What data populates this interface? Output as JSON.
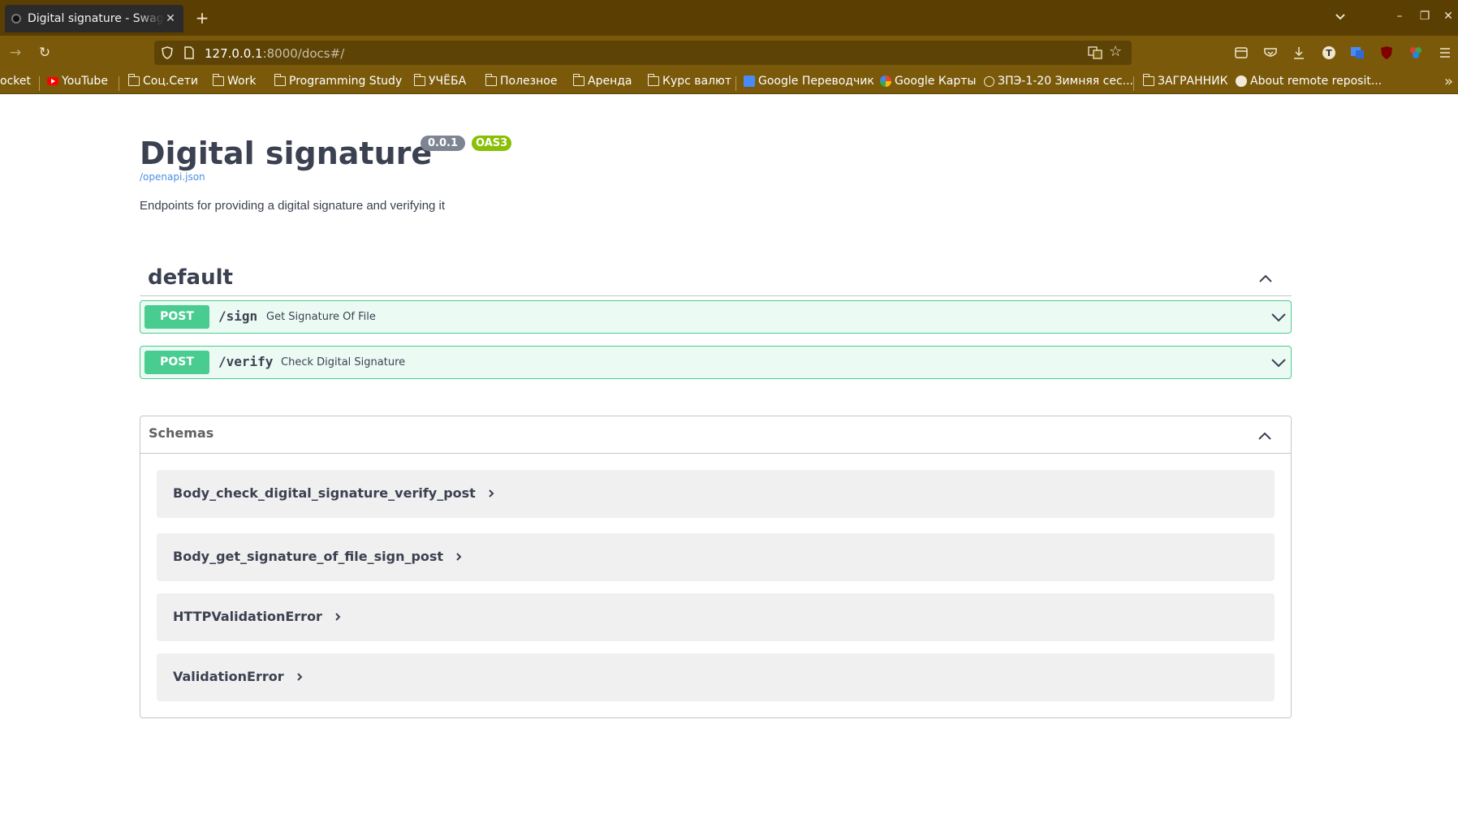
{
  "browser": {
    "tab_title": "Digital signature - Swagger UI",
    "url_host": "127.0.0.1",
    "url_rest": ":8000/docs#/",
    "bookmarks": [
      {
        "label": "ocket",
        "icon": "pocket-icon"
      },
      {
        "label": "YouTube",
        "icon": "youtube-icon"
      },
      {
        "label": "Соц.Сети",
        "icon": "folder-icon"
      },
      {
        "label": "Work",
        "icon": "folder-icon"
      },
      {
        "label": "Programming Study",
        "icon": "folder-icon"
      },
      {
        "label": "УЧЁБА",
        "icon": "folder-icon"
      },
      {
        "label": "Полезное",
        "icon": "folder-icon"
      },
      {
        "label": "Аренда",
        "icon": "folder-icon"
      },
      {
        "label": "Курс валют",
        "icon": "folder-icon"
      },
      {
        "label": "Google Переводчик",
        "icon": "google-translate-icon"
      },
      {
        "label": "Google Карты",
        "icon": "google-maps-icon"
      },
      {
        "label": "ЗПЭ-1-20 Зимняя сес...",
        "icon": "globe-icon"
      },
      {
        "label": "ЗАГРАННИК",
        "icon": "folder-icon"
      },
      {
        "label": "About remote reposit...",
        "icon": "github-icon"
      }
    ]
  },
  "info": {
    "title": "Digital signature",
    "version": "0.0.1",
    "oas": "OAS3",
    "spec_link": "/openapi.json",
    "description": "Endpoints for providing a digital signature and verifying it"
  },
  "tag": {
    "name": "default"
  },
  "operations": [
    {
      "method": "POST",
      "path": "/sign",
      "summary": "Get Signature Of File"
    },
    {
      "method": "POST",
      "path": "/verify",
      "summary": "Check Digital Signature"
    }
  ],
  "schemas": {
    "title": "Schemas",
    "items": [
      "Body_check_digital_signature_verify_post",
      "Body_get_signature_of_file_sign_post",
      "HTTPValidationError",
      "ValidationError"
    ]
  },
  "colors": {
    "post": "#49cc90",
    "chrome": "#7a5a0a",
    "tabbar": "#5a3e02"
  }
}
